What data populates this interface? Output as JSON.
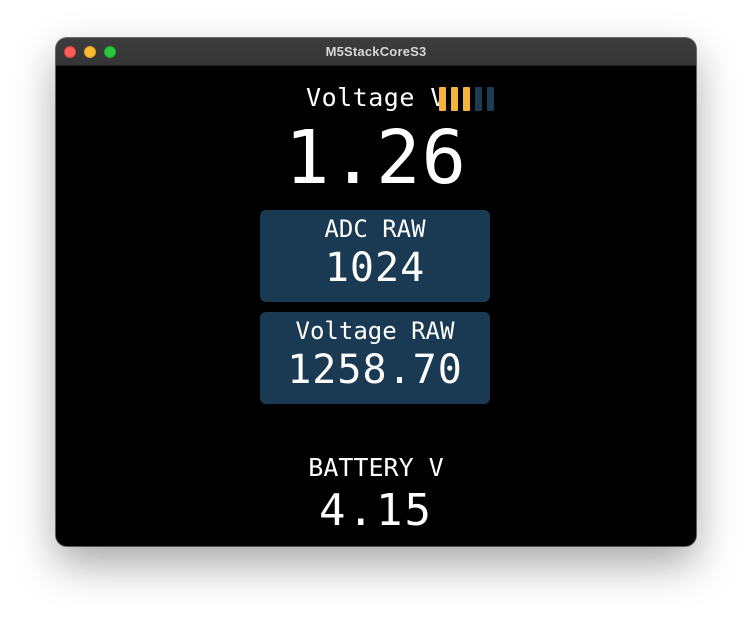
{
  "window": {
    "title": "M5StackCoreS3"
  },
  "display": {
    "voltage_label": "Voltage V",
    "voltage_value": "1.26",
    "level_meter": {
      "filled_segments": 3,
      "total_segments": 5,
      "active_color": "#f4b43c",
      "inactive_color": "#1c3c54"
    },
    "adc_raw": {
      "label": "ADC RAW",
      "value": "1024"
    },
    "voltage_raw": {
      "label": "Voltage RAW",
      "value": "1258.70"
    },
    "battery": {
      "label": "BATTERY V",
      "value": "4.15"
    }
  },
  "colors": {
    "screen_background": "#000000",
    "panel_background": "#193a52",
    "text": "#ffffff"
  }
}
